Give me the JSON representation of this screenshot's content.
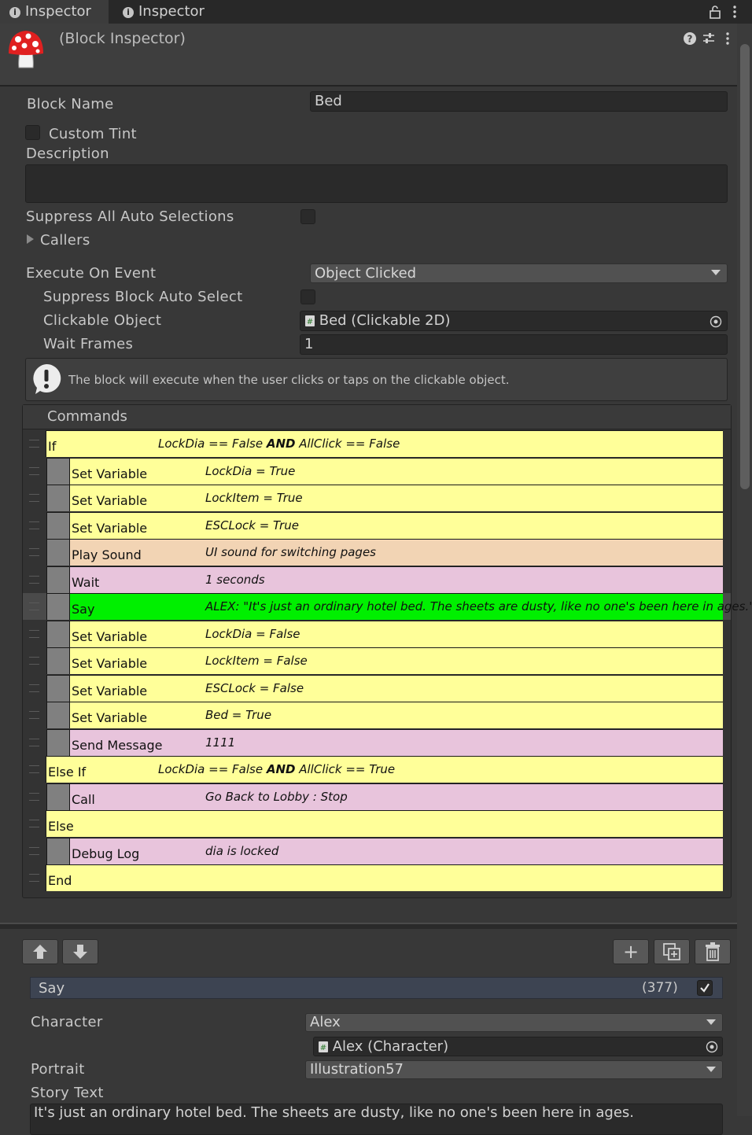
{
  "tabs": [
    {
      "label": "Inspector",
      "icon": "info-icon"
    },
    {
      "label": "Inspector",
      "icon": "info-icon"
    }
  ],
  "header": {
    "title": "(Block Inspector)",
    "icon": "mushroom-icon"
  },
  "block": {
    "name_label": "Block Name",
    "name_value": "Bed",
    "custom_tint_label": "Custom Tint",
    "description_label": "Description",
    "description_value": "",
    "suppress_all_label": "Suppress All Auto Selections",
    "callers_label": "Callers",
    "execute_label": "Execute On Event",
    "execute_value": "Object Clicked",
    "suppress_block_label": "Suppress Block Auto Select",
    "clickable_label": "Clickable Object",
    "clickable_value": "Bed (Clickable 2D)",
    "wait_frames_label": "Wait Frames",
    "wait_frames_value": "1",
    "help_text": "The block will execute when the user clicks or taps on the clickable object."
  },
  "commands": {
    "header": "Commands",
    "rows": [
      {
        "name": "If",
        "indent": 0,
        "color": "#ffff99",
        "summary_html": "LockDia == False <b>AND</b> AllClick == False"
      },
      {
        "name": "Set Variable",
        "indent": 1,
        "color": "#ffff99",
        "summary_html": "LockDia = True"
      },
      {
        "name": "Set Variable",
        "indent": 1,
        "color": "#ffff99",
        "summary_html": "LockItem = True"
      },
      {
        "name": "Set Variable",
        "indent": 1,
        "color": "#ffff99",
        "summary_html": "ESCLock = True"
      },
      {
        "name": "Play Sound",
        "indent": 1,
        "color": "#f2d4b4",
        "summary_html": "UI sound for switching pages"
      },
      {
        "name": "Wait",
        "indent": 1,
        "color": "#e8c4dc",
        "summary_html": "1 seconds"
      },
      {
        "name": "Say",
        "indent": 1,
        "color": "#00f000",
        "selected": true,
        "summary_html": "ALEX: \"It's just an ordinary hotel bed. The sheets are dusty, like no one's been here in ages.\""
      },
      {
        "name": "Set Variable",
        "indent": 1,
        "color": "#ffff99",
        "summary_html": "LockDia = False"
      },
      {
        "name": "Set Variable",
        "indent": 1,
        "color": "#ffff99",
        "summary_html": "LockItem = False"
      },
      {
        "name": "Set Variable",
        "indent": 1,
        "color": "#ffff99",
        "summary_html": "ESCLock = False"
      },
      {
        "name": "Set Variable",
        "indent": 1,
        "color": "#ffff99",
        "summary_html": "Bed = True"
      },
      {
        "name": "Send Message",
        "indent": 1,
        "color": "#e8c4dc",
        "summary_html": "1111"
      },
      {
        "name": "Else If",
        "indent": 0,
        "color": "#ffff99",
        "summary_html": "LockDia == False <b>AND</b> AllClick == True"
      },
      {
        "name": "Call",
        "indent": 1,
        "color": "#e8c4dc",
        "summary_html": "Go Back to Lobby : Stop"
      },
      {
        "name": "Else",
        "indent": 0,
        "color": "#ffff99",
        "summary_html": ""
      },
      {
        "name": "Debug Log",
        "indent": 1,
        "color": "#e8c4dc",
        "summary_html": "dia is locked"
      },
      {
        "name": "End",
        "indent": 0,
        "color": "#ffff99",
        "summary_html": ""
      }
    ]
  },
  "selected_command": {
    "name": "Say",
    "id": "(377)",
    "character_label": "Character",
    "character_value": "Alex",
    "character_object": "Alex (Character)",
    "portrait_label": "Portrait",
    "portrait_value": "Illustration57",
    "story_text_label": "Story Text",
    "story_text_value": "It's just an ordinary hotel bed. The sheets are dusty, like no one's been here in ages."
  },
  "colors": {
    "background": "#383838",
    "if_yellow": "#ffff99",
    "selected_green": "#00f000",
    "sound_peach": "#f2d4b4",
    "flow_pink": "#e8c4dc"
  }
}
